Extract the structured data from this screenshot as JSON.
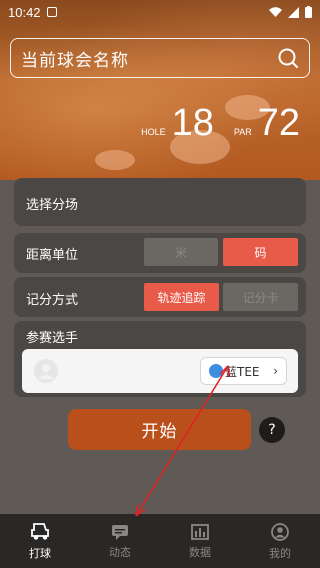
{
  "status_bar": {
    "time": "10:42"
  },
  "header": {
    "search_label": "当前球会名称",
    "hole_label": "HOLE",
    "hole_value": "18",
    "par_label": "PAR",
    "par_value": "72"
  },
  "course": {
    "label": "选择分场"
  },
  "distance": {
    "label": "距离单位",
    "options": [
      "米",
      "码"
    ],
    "selected": "码"
  },
  "scoring": {
    "label": "记分方式",
    "options": [
      "轨迹追踪",
      "记分卡"
    ],
    "selected": "轨迹追踪"
  },
  "players": {
    "label": "参赛选手",
    "tee_label": "蓝TEE"
  },
  "start_label": "开始",
  "help_label": "?",
  "tabbar": {
    "items": [
      "打球",
      "动态",
      "数据",
      "我的"
    ],
    "active": "打球"
  },
  "colors": {
    "accent": "#e85b48",
    "start": "#b9501c",
    "tee": "#3d8de0",
    "annotation": "#e02020"
  }
}
